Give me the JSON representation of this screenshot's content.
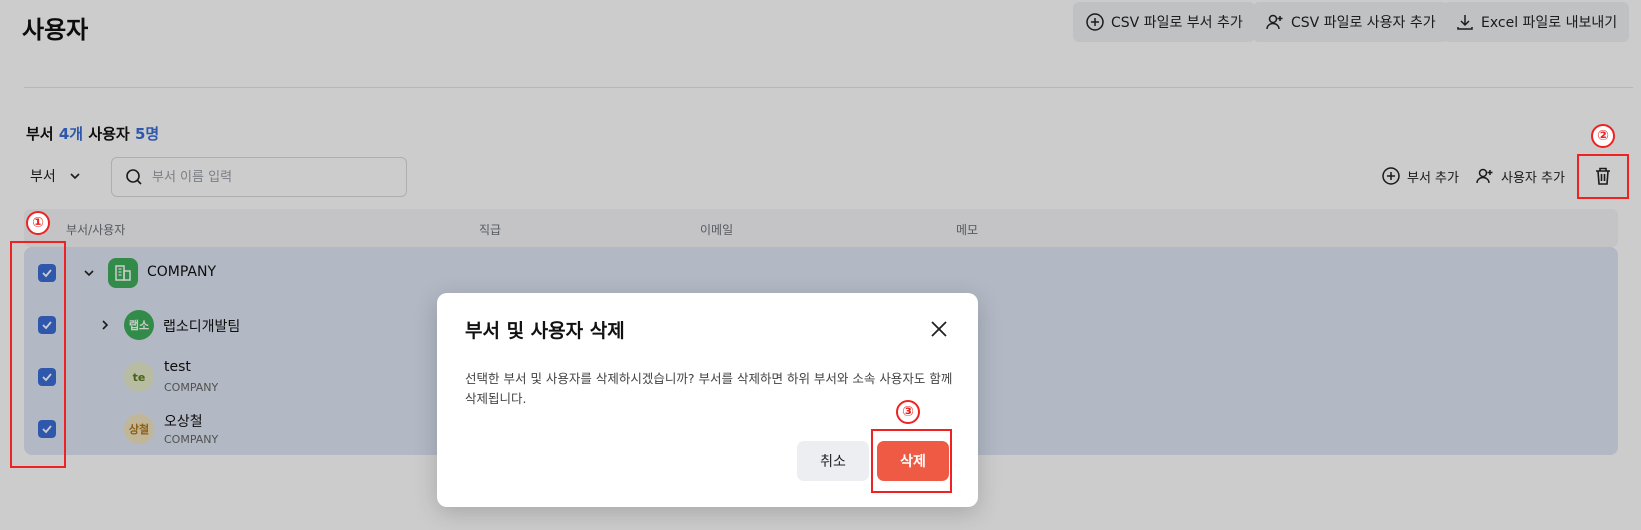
{
  "page": {
    "title": "사용자"
  },
  "top_actions": {
    "csv_dept": "CSV 파일로 부서 추가",
    "csv_user": "CSV 파일로 사용자 추가",
    "excel_export": "Excel 파일로 내보내기"
  },
  "summary": {
    "dept_label": "부서",
    "dept_count": "4개",
    "user_label": "사용자",
    "user_count": "5명"
  },
  "filter": {
    "dept_select": "부서",
    "search_placeholder": "부서 이름 입력"
  },
  "list_actions": {
    "add_dept": "부서 추가",
    "add_user": "사용자 추가"
  },
  "columns": [
    "부서/사용자",
    "직급",
    "이메일",
    "메모"
  ],
  "rows": [
    {
      "name": "COMPANY",
      "sub": ""
    },
    {
      "name": "랩소디개발팀",
      "avatar": "랩소",
      "sub": ""
    },
    {
      "name": "test",
      "avatar": "te",
      "sub": "COMPANY"
    },
    {
      "name": "오상철",
      "avatar": "상철",
      "sub": "COMPANY"
    }
  ],
  "modal": {
    "title": "부서 및 사용자 삭제",
    "body": "선택한 부서 및 사용자를 삭제하시겠습니까? 부서를 삭제하면 하위 부서와 소속 사용자도 함께 삭제됩니다.",
    "cancel": "취소",
    "delete": "삭제"
  },
  "markers": [
    "①",
    "②",
    "③"
  ],
  "colors": {
    "accent": "#3b6fd8",
    "danger": "#ef5a44",
    "highlight": "#e22222",
    "row_selected": "#dfe7f5"
  }
}
